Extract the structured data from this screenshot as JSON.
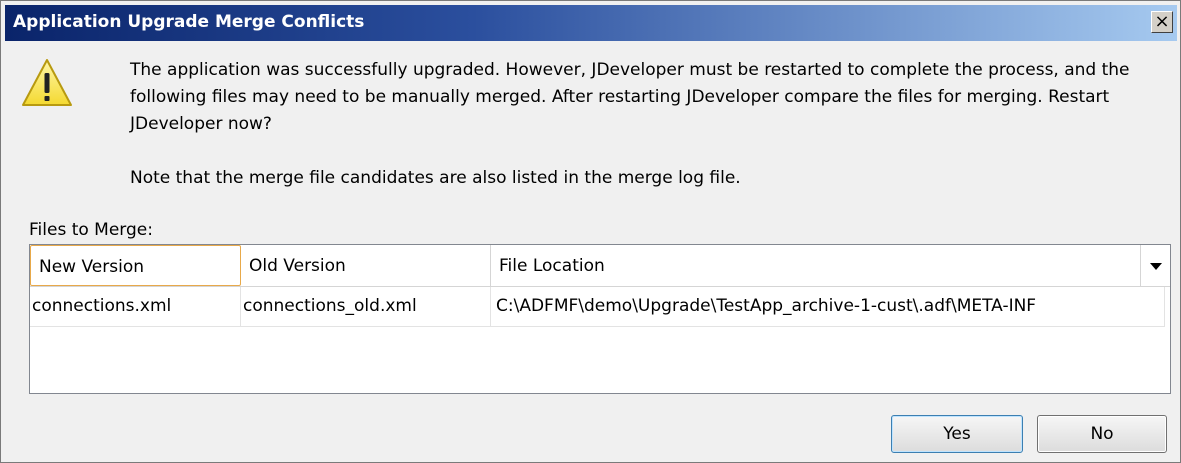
{
  "window": {
    "title": "Application Upgrade Merge Conflicts",
    "close_glyph": "×"
  },
  "message": {
    "body": "The application was successfully upgraded. However, JDeveloper must be restarted to complete the process, and the following files may need to be manually merged. After restarting JDeveloper compare the files for merging. Restart JDeveloper now?",
    "note": "Note that the merge file candidates are also listed in the merge log file.",
    "icon": "warning-icon",
    "icon_color": "#f8e85a"
  },
  "files": {
    "label": "Files to Merge:",
    "columns": [
      "New Version",
      "Old Version",
      "File Location"
    ],
    "rows": [
      {
        "new_version": "connections.xml",
        "old_version": "connections_old.xml",
        "file_location": "C:\\ADFMF\\demo\\Upgrade\\TestApp_archive-1-cust\\.adf\\META-INF"
      }
    ]
  },
  "buttons": {
    "yes": "Yes",
    "no": "No"
  }
}
